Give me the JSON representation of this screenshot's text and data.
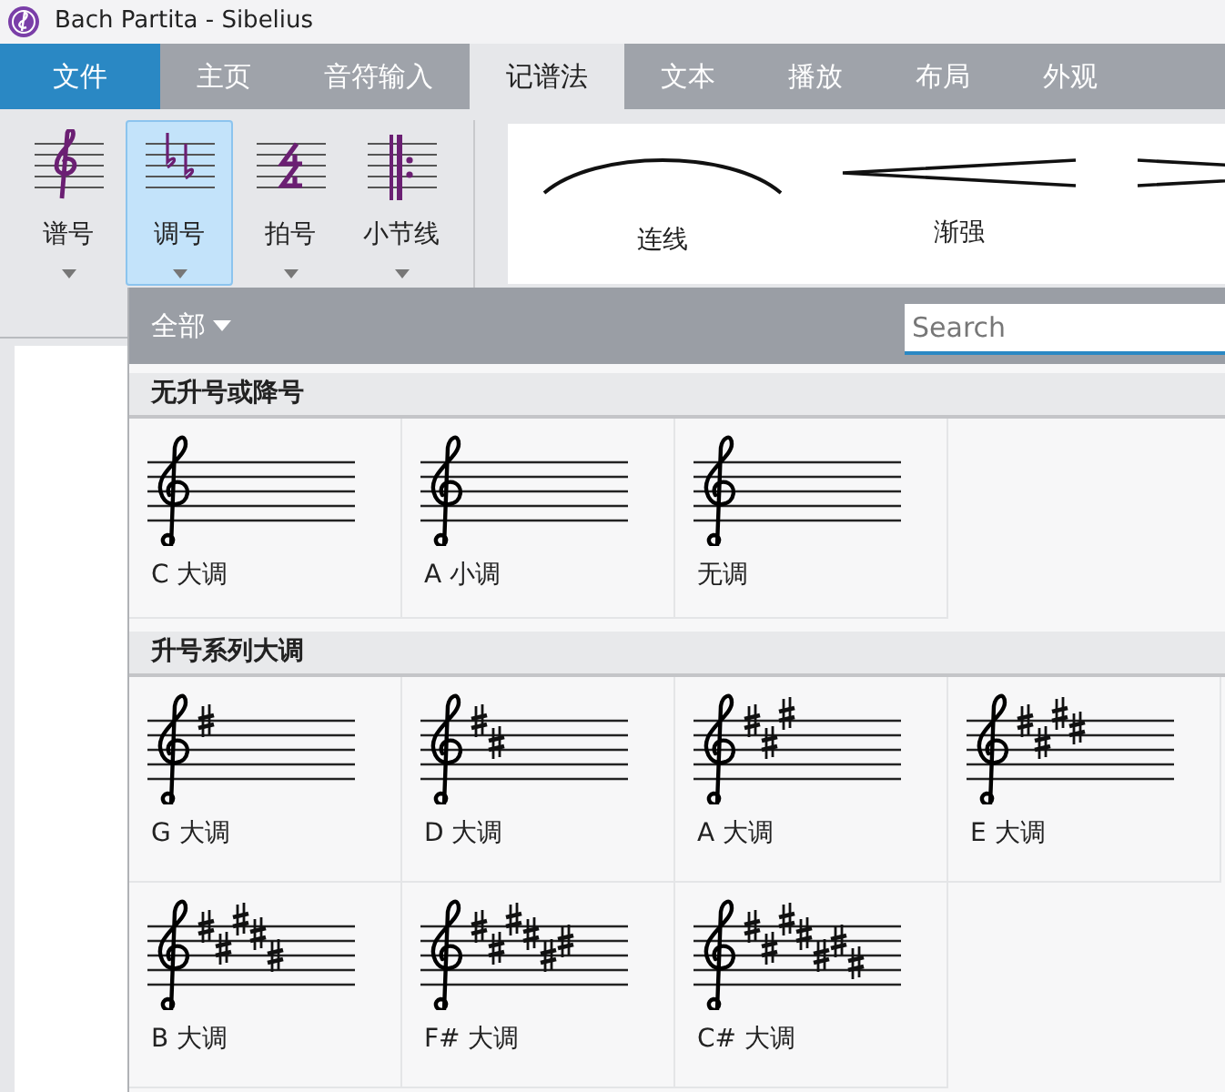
{
  "window": {
    "title": "Bach Partita - Sibelius"
  },
  "tabs": [
    {
      "label": "文件",
      "kind": "file"
    },
    {
      "label": "主页",
      "kind": "tab",
      "selected": false
    },
    {
      "label": "音符输入",
      "kind": "tab",
      "selected": false
    },
    {
      "label": "记谱法",
      "kind": "tab",
      "selected": true
    },
    {
      "label": "文本",
      "kind": "tab",
      "selected": false
    },
    {
      "label": "播放",
      "kind": "tab",
      "selected": false
    },
    {
      "label": "布局",
      "kind": "tab",
      "selected": false
    },
    {
      "label": "外观",
      "kind": "tab",
      "selected": false
    }
  ],
  "ribbon_buttons": [
    {
      "label": "谱号",
      "kind": "clef",
      "selected": false
    },
    {
      "label": "调号",
      "kind": "key",
      "selected": true
    },
    {
      "label": "拍号",
      "kind": "time",
      "selected": false
    },
    {
      "label": "小节线",
      "kind": "barline",
      "selected": false
    }
  ],
  "line_gallery": [
    {
      "label": "连线",
      "kind": "slur"
    },
    {
      "label": "渐强",
      "kind": "crescendo"
    },
    {
      "kind": "diminuendo"
    }
  ],
  "dropdown": {
    "filter": "全部",
    "search": {
      "placeholder": "Search"
    },
    "sections": [
      {
        "title": "无升号或降号",
        "kind": "none",
        "items": [
          "C 大调",
          "A 小调",
          "无调"
        ]
      },
      {
        "title": "升号系列大调",
        "kind": "sharps",
        "items": [
          "G 大调",
          "D 大调",
          "A 大调",
          "E 大调",
          "B 大调",
          "F# 大调",
          "C# 大调"
        ]
      }
    ]
  }
}
